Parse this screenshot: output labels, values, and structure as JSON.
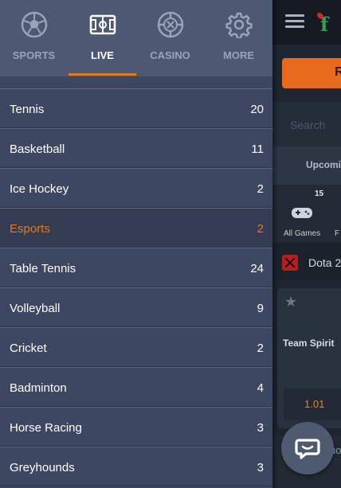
{
  "nav": {
    "items": [
      {
        "label": "SPORTS",
        "icon": "soccer-ball-icon"
      },
      {
        "label": "LIVE",
        "icon": "pitch-icon"
      },
      {
        "label": "CASINO",
        "icon": "casino-chip-icon"
      },
      {
        "label": "MORE",
        "icon": "gear-icon"
      }
    ],
    "active_index": 1
  },
  "sports": [
    {
      "name": "Tennis",
      "count": "20"
    },
    {
      "name": "Basketball",
      "count": "11"
    },
    {
      "name": "Ice Hockey",
      "count": "2"
    },
    {
      "name": "Esports",
      "count": "2",
      "active": true
    },
    {
      "name": "Table Tennis",
      "count": "24"
    },
    {
      "name": "Volleyball",
      "count": "9"
    },
    {
      "name": "Cricket",
      "count": "2"
    },
    {
      "name": "Badminton",
      "count": "4"
    },
    {
      "name": "Horse Racing",
      "count": "3"
    },
    {
      "name": "Greyhounds",
      "count": "3"
    }
  ],
  "background": {
    "cta_label": "R",
    "search_placeholder": "Search",
    "tab_upcoming": "Upcomi",
    "games_count": "15",
    "all_games_label": "All Games",
    "fo_label": "F",
    "dota_label": "Dota 2",
    "team_label": "Team Spirit",
    "odds_value": "1.01",
    "lower_text": "uo"
  },
  "colors": {
    "accent": "#e07a22",
    "drawer_bg": "#3d4761",
    "drawer_header_bg": "#4d5873",
    "active_row_bg": "#343c51"
  }
}
